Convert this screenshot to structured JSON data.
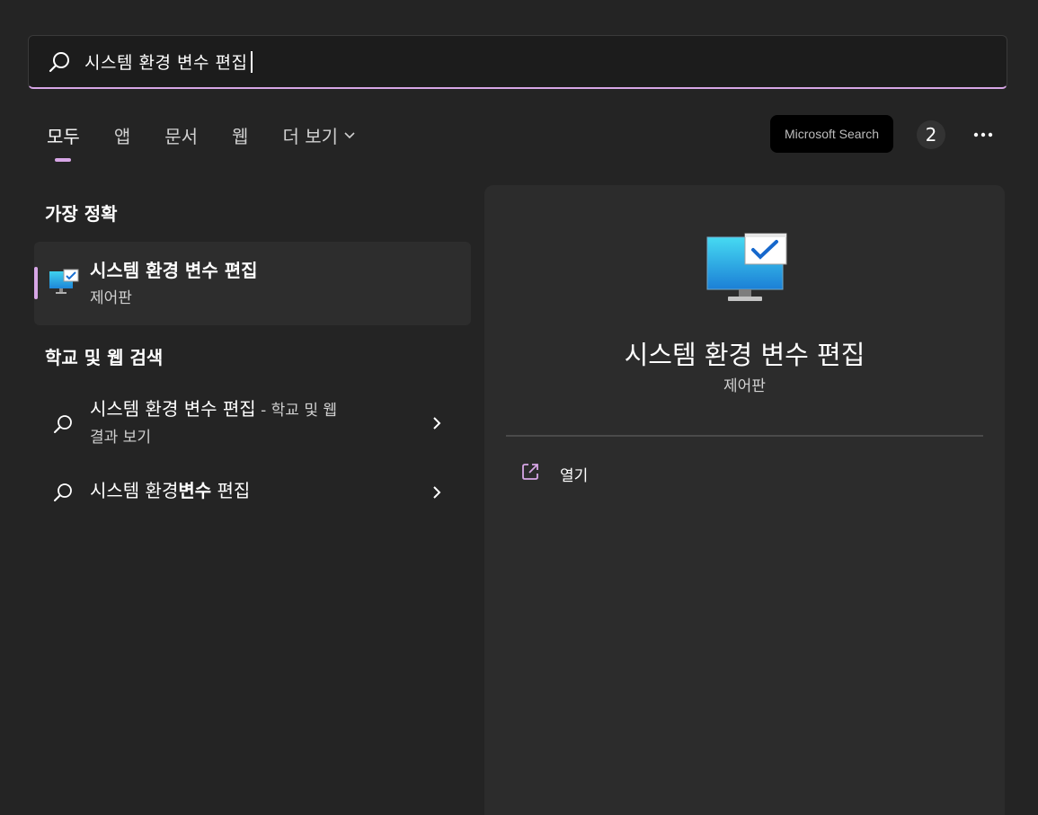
{
  "search": {
    "query": "시스템 환경 변수 편집"
  },
  "tabs": [
    {
      "label": "모두"
    },
    {
      "label": "앱"
    },
    {
      "label": "문서"
    },
    {
      "label": "웹"
    },
    {
      "label": "더 보기"
    }
  ],
  "header_right": {
    "ms_search_label": "Microsoft Search",
    "badge_count": "2"
  },
  "best_match": {
    "section_title": "가장 정확",
    "title": "시스템 환경 변수 편집",
    "subtitle": "제어판"
  },
  "web_search": {
    "section_title": "학교 및 웹 검색",
    "items": [
      {
        "text": "시스템 환경 변수 편집",
        "suffix": " - 학교 및 웹",
        "line2": "결과 보기"
      },
      {
        "text_plain_1": "시스템 환경",
        "text_bold": "변수",
        "text_plain_2": " 편집"
      }
    ]
  },
  "detail": {
    "title": "시스템 환경 변수 편집",
    "subtitle": "제어판",
    "actions": [
      {
        "label": "열기",
        "icon": "open-external-icon"
      }
    ]
  },
  "colors": {
    "accent": "#d7a6e6",
    "background": "#242424",
    "panel": "#2c2c2c"
  }
}
